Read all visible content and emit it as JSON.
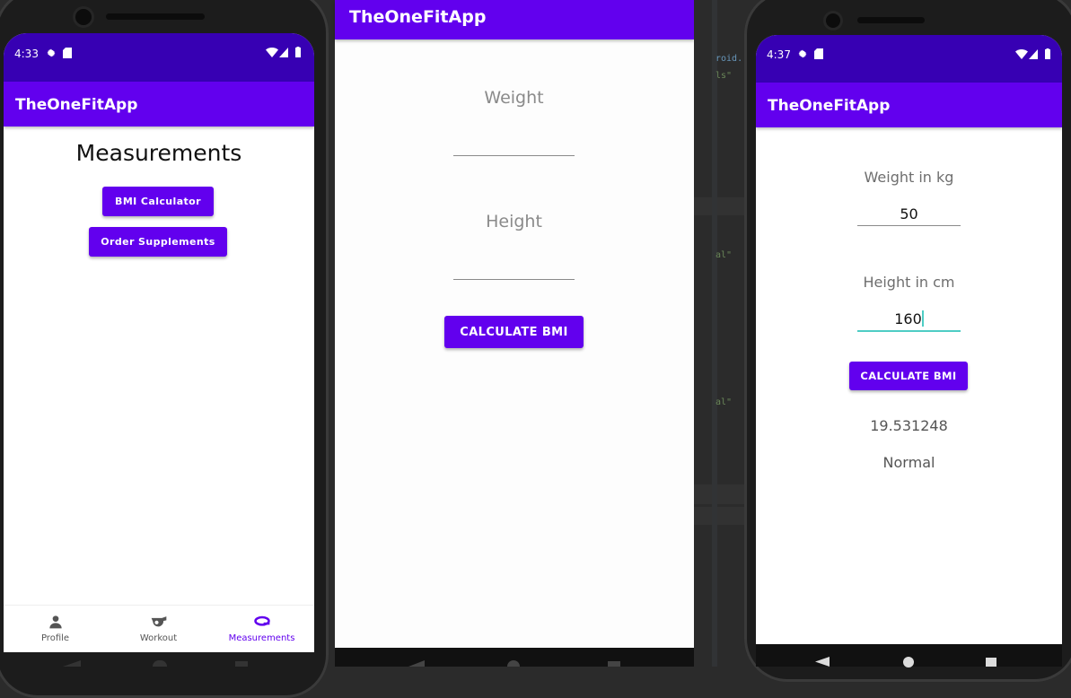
{
  "app_title": "TheOneFitApp",
  "phone_left": {
    "status_time": "4:33",
    "page_title": "Measurements",
    "bmi_button_label": "BMI Calculator",
    "supplements_button_label": "Order Supplements",
    "nav": [
      {
        "label": "Profile",
        "icon": "person-icon",
        "active": false
      },
      {
        "label": "Workout",
        "icon": "whistle-icon",
        "active": false
      },
      {
        "label": "Measurements",
        "icon": "tape-measure-icon",
        "active": true
      }
    ]
  },
  "phone_middle": {
    "weight_hint": "Weight",
    "height_hint": "Height",
    "calculate_label": "CALCULATE BMI"
  },
  "ide": {
    "snippets": [
      "roid.",
      "ls\"",
      "al\"",
      "al\""
    ]
  },
  "phone_right": {
    "status_time": "4:37",
    "weight_hint": "Weight in kg",
    "weight_value": "50",
    "height_hint": "Height in cm",
    "height_value": "160",
    "calculate_label": "CALCULATE BMI",
    "bmi_result": "19.531248",
    "bmi_category": "Normal"
  },
  "colors": {
    "primary": "#6200ee",
    "primary_dark": "#3700b3",
    "focus_accent": "#4ecdc4"
  }
}
